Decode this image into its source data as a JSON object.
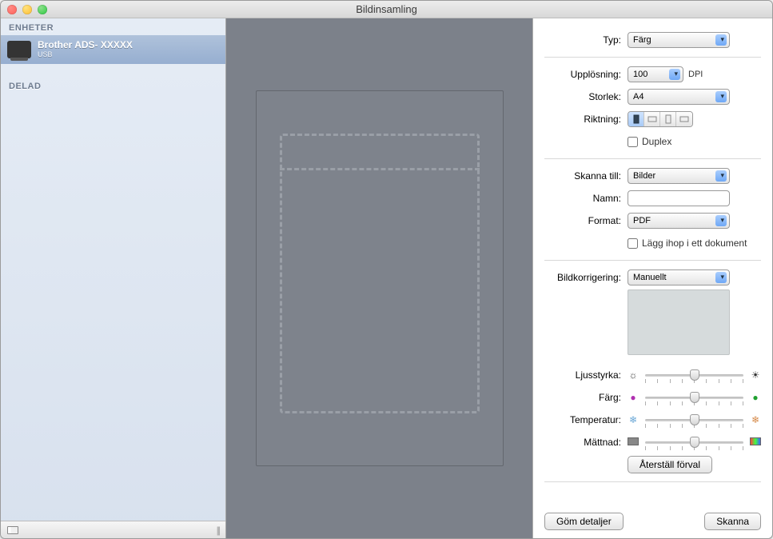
{
  "window": {
    "title": "Bildinsamling"
  },
  "sidebar": {
    "devices_header": "ENHETER",
    "device": {
      "name": "Brother ADS- XXXXX",
      "sub": "USB"
    },
    "shared_header": "DELAD"
  },
  "labels": {
    "type": "Typ:",
    "resolution": "Upplösning:",
    "dpi": "DPI",
    "size": "Storlek:",
    "direction": "Riktning:",
    "duplex": "Duplex",
    "scan_to": "Skanna till:",
    "name": "Namn:",
    "format": "Format:",
    "combine": "Lägg ihop i ett dokument",
    "correction": "Bildkorrigering:",
    "brightness": "Ljusstyrka:",
    "color": "Färg:",
    "temperature": "Temperatur:",
    "saturation": "Mättnad:"
  },
  "values": {
    "type": "Färg",
    "resolution": "100",
    "size": "A4",
    "scan_to": "Bilder",
    "name_input": "",
    "format": "PDF",
    "correction": "Manuellt",
    "duplex_checked": false,
    "combine_checked": false,
    "direction_selected": 0,
    "brightness": 50,
    "color": 50,
    "temperature": 50,
    "saturation": 50
  },
  "buttons": {
    "reset": "Återställ förval",
    "hide_details": "Göm detaljer",
    "scan": "Skanna"
  }
}
